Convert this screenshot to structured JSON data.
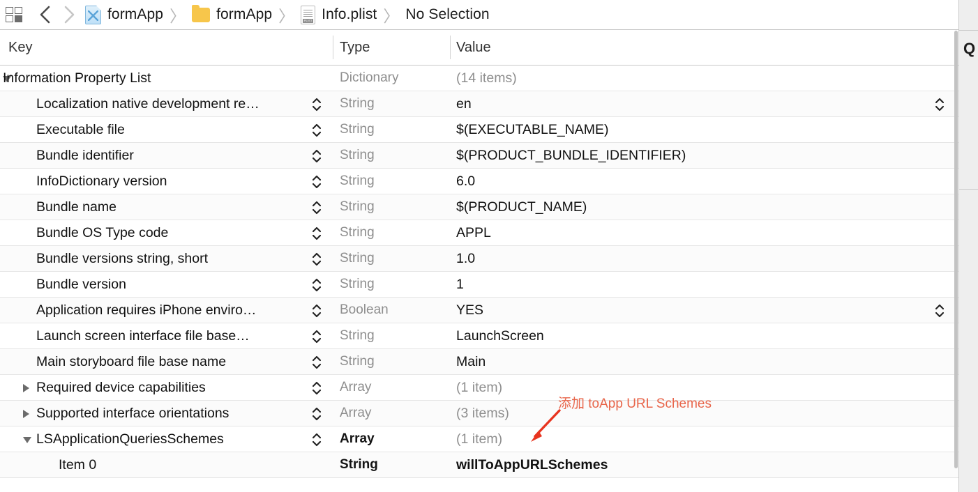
{
  "window": {
    "title": "Info.plist"
  },
  "toolbar": {
    "panel_toggle_icon": "panel-layout-icon",
    "back_label": "Back",
    "forward_label": "Forward",
    "breadcrumbs": [
      {
        "icon": "xcode-project-icon",
        "label": "formApp"
      },
      {
        "icon": "folder-icon",
        "label": "formApp"
      },
      {
        "icon": "plist-file-icon",
        "label": "Info.plist"
      },
      {
        "icon": "none",
        "label": "No Selection"
      }
    ],
    "separator": "〉"
  },
  "inspector_strip": {
    "quick_help_label": "Q"
  },
  "table": {
    "columns": [
      "Key",
      "Type",
      "Value"
    ],
    "rows": [
      {
        "key": "Information Property List",
        "type": "Dictionary",
        "value": "(14 items)",
        "indent": 0,
        "disclosure": "open",
        "key_stepper": false,
        "value_stepper": false,
        "type_strong": false,
        "value_muted": true
      },
      {
        "key": "Localization native development re…",
        "type": "String",
        "value": "en",
        "indent": 1,
        "disclosure": "none",
        "key_stepper": true,
        "value_stepper": true,
        "type_strong": false,
        "value_muted": false
      },
      {
        "key": "Executable file",
        "type": "String",
        "value": "$(EXECUTABLE_NAME)",
        "indent": 1,
        "disclosure": "none",
        "key_stepper": true,
        "value_stepper": false,
        "type_strong": false,
        "value_muted": false
      },
      {
        "key": "Bundle identifier",
        "type": "String",
        "value": "$(PRODUCT_BUNDLE_IDENTIFIER)",
        "indent": 1,
        "disclosure": "none",
        "key_stepper": true,
        "value_stepper": false,
        "type_strong": false,
        "value_muted": false
      },
      {
        "key": "InfoDictionary version",
        "type": "String",
        "value": "6.0",
        "indent": 1,
        "disclosure": "none",
        "key_stepper": true,
        "value_stepper": false,
        "type_strong": false,
        "value_muted": false
      },
      {
        "key": "Bundle name",
        "type": "String",
        "value": "$(PRODUCT_NAME)",
        "indent": 1,
        "disclosure": "none",
        "key_stepper": true,
        "value_stepper": false,
        "type_strong": false,
        "value_muted": false
      },
      {
        "key": "Bundle OS Type code",
        "type": "String",
        "value": "APPL",
        "indent": 1,
        "disclosure": "none",
        "key_stepper": true,
        "value_stepper": false,
        "type_strong": false,
        "value_muted": false
      },
      {
        "key": "Bundle versions string, short",
        "type": "String",
        "value": "1.0",
        "indent": 1,
        "disclosure": "none",
        "key_stepper": true,
        "value_stepper": false,
        "type_strong": false,
        "value_muted": false
      },
      {
        "key": "Bundle version",
        "type": "String",
        "value": "1",
        "indent": 1,
        "disclosure": "none",
        "key_stepper": true,
        "value_stepper": false,
        "type_strong": false,
        "value_muted": false
      },
      {
        "key": "Application requires iPhone enviro…",
        "type": "Boolean",
        "value": "YES",
        "indent": 1,
        "disclosure": "none",
        "key_stepper": true,
        "value_stepper": true,
        "type_strong": false,
        "value_muted": false
      },
      {
        "key": "Launch screen interface file base…",
        "type": "String",
        "value": "LaunchScreen",
        "indent": 1,
        "disclosure": "none",
        "key_stepper": true,
        "value_stepper": false,
        "type_strong": false,
        "value_muted": false
      },
      {
        "key": "Main storyboard file base name",
        "type": "String",
        "value": "Main",
        "indent": 1,
        "disclosure": "none",
        "key_stepper": true,
        "value_stepper": false,
        "type_strong": false,
        "value_muted": false
      },
      {
        "key": "Required device capabilities",
        "type": "Array",
        "value": "(1 item)",
        "indent": 1,
        "disclosure": "closed",
        "key_stepper": true,
        "value_stepper": false,
        "type_strong": false,
        "value_muted": true
      },
      {
        "key": "Supported interface orientations",
        "type": "Array",
        "value": "(3 items)",
        "indent": 1,
        "disclosure": "closed",
        "key_stepper": true,
        "value_stepper": false,
        "type_strong": false,
        "value_muted": true
      },
      {
        "key": "LSApplicationQueriesSchemes",
        "type": "Array",
        "value": "(1 item)",
        "indent": 1,
        "disclosure": "open",
        "key_stepper": true,
        "value_stepper": false,
        "type_strong": true,
        "value_muted": true
      },
      {
        "key": "Item 0",
        "type": "String",
        "value": "willToAppURLSchemes",
        "indent": 2,
        "disclosure": "none",
        "key_stepper": false,
        "value_stepper": false,
        "type_strong": true,
        "value_muted": false
      }
    ]
  },
  "annotation": {
    "text": "添加 toApp URL Schemes",
    "color": "#e8654a",
    "arrow": "down-left-arrow"
  }
}
